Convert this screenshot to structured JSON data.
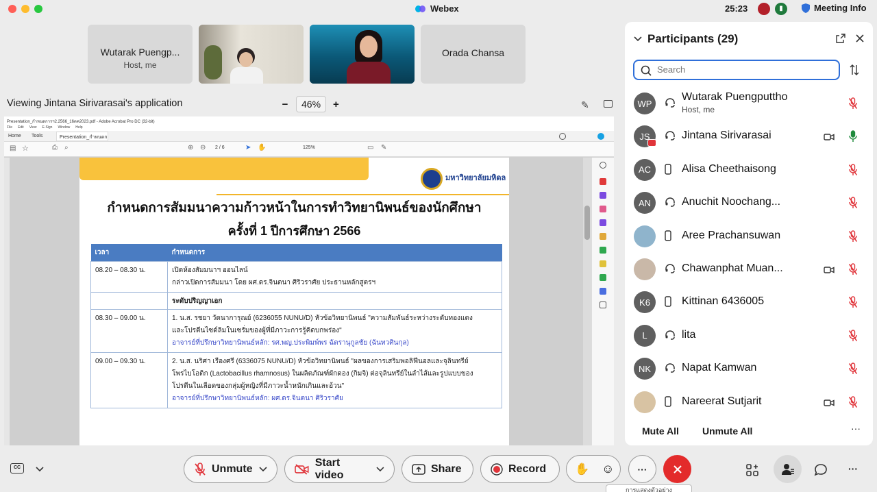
{
  "app": {
    "title": "Webex",
    "timer": "25:23",
    "meeting_info": "Meeting Info"
  },
  "tiles": [
    {
      "name": "Wutarak Puengp...",
      "sub": "Host, me",
      "type": "avatar"
    },
    {
      "name": "",
      "sub": "",
      "type": "video"
    },
    {
      "name": "",
      "sub": "",
      "type": "video"
    },
    {
      "name": "Orada Chansa",
      "sub": "",
      "type": "avatar"
    }
  ],
  "viewing": {
    "label": "Viewing Jintana Sirivarasai's application",
    "zoom": "46%",
    "minus": "−",
    "plus": "+"
  },
  "acrobat": {
    "title": "Presentation_กำหนดการฯ2.2566_16ตค2023.pdf - Adobe Acrobat Pro DC (32-bit)",
    "menu": [
      "File",
      "Edit",
      "View",
      "E-Sign",
      "Window",
      "Help"
    ],
    "tabs": [
      "Home",
      "Tools",
      "Presentation_กำหนดก..."
    ],
    "page": "2 / 6",
    "zoom": "125%"
  },
  "pdf": {
    "university": "มหาวิทยาลัยมหิดล",
    "title_line1": "กำหนดการสัมมนาความก้าวหน้าในการทำวิทยานิพนธ์ของนักศึกษา",
    "title_line2": "ครั้งที่ 1 ปีการศึกษา 2566",
    "headers": [
      "เวลา",
      "กำหนดการ"
    ],
    "rows": [
      {
        "time": "08.20 – 08.30 น.",
        "lines": [
          "เปิดห้องสัมมนาฯ ออนไลน์",
          "กล่าวเปิดการสัมมนา โดย ผศ.ดร.จินตนา ศิริวราศัย ประธานหลักสูตรฯ"
        ],
        "advisor": ""
      },
      {
        "time": "",
        "lines": [
          "ระดับปริญญาเอก"
        ],
        "advisor": "",
        "bold": true
      },
      {
        "time": "08.30 – 09.00 น.",
        "lines": [
          "1. น.ส. รชยา วัดนาการุณย์ (6236055 NUNU/D) หัวข้อวิทยานิพนธ์ \"ความสัมพันธ์ระหว่างระดับทองแดง",
          "และโปรตีนไซด์ลิมในเซรั่มของผู้ที่มีภาวะการรู้คิดบกพร่อง\""
        ],
        "advisor": "อาจารย์ที่ปรึกษาวิทยานิพนธ์หลัก: รศ.พญ.ประพิมพ์พร ฉัตรานุกูลชัย (ฉันทวศินกุล)"
      },
      {
        "time": "09.00 – 09.30 น.",
        "lines": [
          "2. น.ส. นริศา เรืองศรี (6336075 NUNU/D) หัวข้อวิทยานิพนธ์ \"ผลของการเสริมพอลิฟีนอลและจุลินทรีย์",
          "โพรไบโอติก (Lactobacillus rhamnosus) ในผลิตภัณฑ์ผักดอง (กิมจิ) ต่อจุลินทรีย์ในลำไส้และรูปแบบของ",
          "โปรตีนในเลือดของกลุ่มผู้หญิงที่มีภาวะน้ำหนักเกินและอ้วน\""
        ],
        "advisor": "อาจารย์ที่ปรึกษาวิทยานิพนธ์หลัก: ผศ.ดร.จินตนา ศิริวราศัย"
      }
    ]
  },
  "participants": {
    "title": "Participants (29)",
    "search_placeholder": "Search",
    "list": [
      {
        "initials": "WP",
        "name": "Wutarak Puengputtho",
        "sub": "Host, me",
        "device": "headset",
        "video": false,
        "mic": "muted",
        "photo": false
      },
      {
        "initials": "JS",
        "name": "Jintana Sirivarasai",
        "sub": "",
        "device": "headset",
        "video": true,
        "mic": "on",
        "photo": false
      },
      {
        "initials": "AC",
        "name": "Alisa Cheethaisong",
        "sub": "",
        "device": "phone",
        "video": false,
        "mic": "muted",
        "photo": false
      },
      {
        "initials": "AN",
        "name": "Anuchit Noochang...",
        "sub": "",
        "device": "headset",
        "video": false,
        "mic": "muted",
        "photo": false
      },
      {
        "initials": "",
        "name": "Aree Prachansuwan",
        "sub": "",
        "device": "phone",
        "video": false,
        "mic": "muted",
        "photo": true
      },
      {
        "initials": "",
        "name": "Chawanphat Muan...",
        "sub": "",
        "device": "headset",
        "video": true,
        "mic": "muted",
        "photo": true
      },
      {
        "initials": "K6",
        "name": "Kittinan 6436005",
        "sub": "",
        "device": "phone",
        "video": false,
        "mic": "muted",
        "photo": false
      },
      {
        "initials": "L",
        "name": "lita",
        "sub": "",
        "device": "headset",
        "video": false,
        "mic": "muted",
        "photo": false
      },
      {
        "initials": "NK",
        "name": "Napat Kamwan",
        "sub": "",
        "device": "headset",
        "video": false,
        "mic": "muted",
        "photo": false
      },
      {
        "initials": "",
        "name": "Nareerat Sutjarit",
        "sub": "",
        "device": "phone",
        "video": true,
        "mic": "muted",
        "photo": true
      }
    ],
    "mute_all": "Mute All",
    "unmute_all": "Unmute All",
    "more": "···"
  },
  "toolbar": {
    "unmute": "Unmute",
    "start_video": "Start video",
    "share": "Share",
    "record": "Record",
    "more": "···",
    "tooltip": "การแสดงตัวอย่าง"
  },
  "colors": {
    "accent": "#2f6fd9",
    "mute_red": "#e0343a",
    "end_red": "#e32b2b",
    "table_head": "#4a7cc2",
    "advisor_blue": "#3949c9"
  }
}
